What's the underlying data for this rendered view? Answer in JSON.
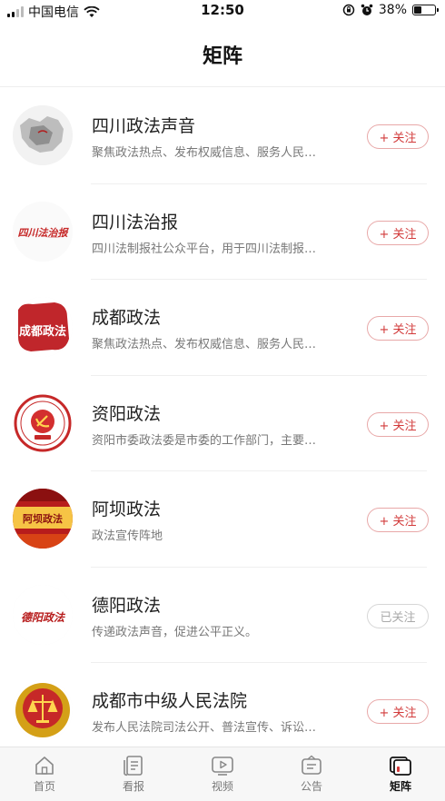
{
  "status_bar": {
    "carrier": "中国电信",
    "time": "12:50",
    "battery": "38%",
    "battery_level": 0.38
  },
  "header": {
    "title": "矩阵"
  },
  "accounts": [
    {
      "name": "四川政法声音",
      "desc": "聚焦政法热点、发布权威信息、服务人民群众",
      "button": "+ 关注",
      "followed": false,
      "avatar_icon": "sichuan-map-logo"
    },
    {
      "name": "四川法治报",
      "desc": "四川法制报社公众平台，用于四川法制报社新闻发布",
      "button": "+ 关注",
      "followed": false,
      "avatar_icon": "calligraphy-logo",
      "avatar_text": "四川法治报"
    },
    {
      "name": "成都政法",
      "desc": "聚焦政法热点、发布权威信息、服务人民群众",
      "button": "+ 关注",
      "followed": false,
      "avatar_icon": "seal-logo",
      "avatar_text": "成都政法"
    },
    {
      "name": "资阳政法",
      "desc": "资阳市委政法委是市委的工作部门，主要职责是",
      "button": "+ 关注",
      "followed": false,
      "avatar_icon": "party-emblem-logo"
    },
    {
      "name": "阿坝政法",
      "desc": "政法宣传阵地",
      "button": "+ 关注",
      "followed": false,
      "avatar_icon": "banner-logo",
      "avatar_text": "阿坝政法"
    },
    {
      "name": "德阳政法",
      "desc": "传递政法声音，促进公平正义。",
      "button": "已关注",
      "followed": true,
      "avatar_icon": "calligraphy-logo",
      "avatar_text": "德阳政法"
    },
    {
      "name": "成都市中级人民法院",
      "desc": "发布人民法院司法公开、普法宣传、诉讼服务信息",
      "button": "+ 关注",
      "followed": false,
      "avatar_icon": "court-emblem-logo"
    }
  ],
  "tabs": [
    {
      "label": "首页",
      "icon": "home-icon",
      "active": false
    },
    {
      "label": "看报",
      "icon": "newspaper-icon",
      "active": false
    },
    {
      "label": "视频",
      "icon": "video-icon",
      "active": false
    },
    {
      "label": "公告",
      "icon": "notice-icon",
      "active": false
    },
    {
      "label": "矩阵",
      "icon": "matrix-icon",
      "active": true
    }
  ],
  "colors": {
    "accent": "#d23a3a",
    "followed": "#aaaaaa",
    "tab_active": "#111111"
  }
}
